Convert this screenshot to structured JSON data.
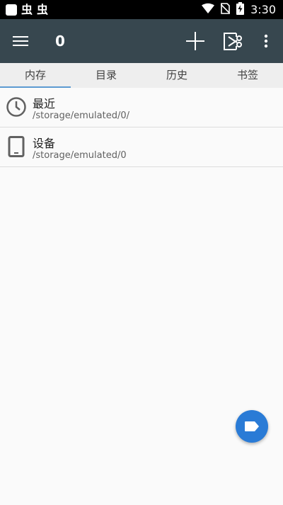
{
  "status_bar": {
    "notification_glyphs": [
      "虫",
      "虫"
    ],
    "time": "3:30",
    "icons": [
      "wifi-icon",
      "no-sim-icon",
      "battery-charging-icon"
    ]
  },
  "toolbar": {
    "title": "0",
    "background": "#37474f",
    "icons": [
      "menu-icon",
      "add-icon",
      "cut-icon",
      "more-vert-icon"
    ]
  },
  "tabs": [
    {
      "label": "内存",
      "active": true
    },
    {
      "label": "目录",
      "active": false
    },
    {
      "label": "历史",
      "active": false
    },
    {
      "label": "书签",
      "active": false
    }
  ],
  "list": [
    {
      "title": "最近",
      "path": "/storage/emulated/0/",
      "icon": "clock-icon"
    },
    {
      "title": "设备",
      "path": "/storage/emulated/0",
      "icon": "device-icon"
    }
  ],
  "fab": {
    "icon": "label-icon",
    "color": "#2a7bd6"
  },
  "colors": {
    "accent": "#5c9bd1",
    "tab_background": "#eeeeee",
    "page_background": "#fafafa"
  }
}
